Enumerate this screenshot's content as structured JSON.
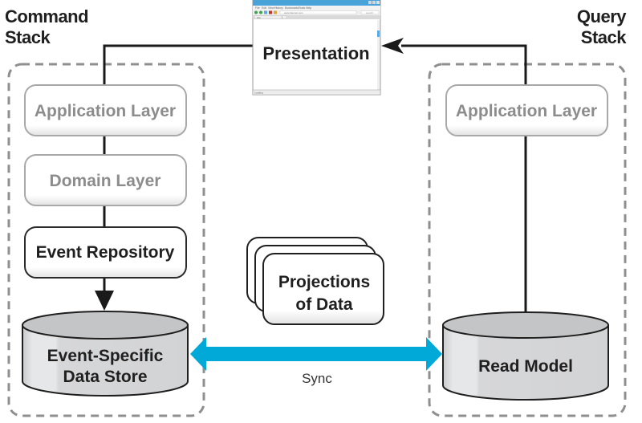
{
  "command_stack": {
    "title_line1": "Command",
    "title_line2": "Stack",
    "application_layer": "Application Layer",
    "domain_layer": "Domain Layer",
    "event_repository": "Event Repository",
    "data_store_line1": "Event-Specific",
    "data_store_line2": "Data Store"
  },
  "query_stack": {
    "title_line1": "Query",
    "title_line2": "Stack",
    "application_layer": "Application Layer",
    "read_model": "Read Model"
  },
  "presentation": {
    "label": "Presentation",
    "browser": {
      "menu_items": [
        "File",
        "Edit",
        "View",
        "History",
        "Bookmarks",
        "Tools",
        "Help"
      ],
      "address": "www.internet.com",
      "search_placeholder": "search",
      "tab_label": "site",
      "status": "Loading"
    }
  },
  "projections": {
    "line1": "Projections",
    "line2": "of Data"
  },
  "sync": {
    "label": "Sync"
  },
  "colors": {
    "sync_arrow": "#00a9d8",
    "dashed_border": "#8f8f8f",
    "inactive_text": "#8c8c8c",
    "active_text": "#1f1f1f",
    "cylinder_fill": "#d4d5d7"
  }
}
